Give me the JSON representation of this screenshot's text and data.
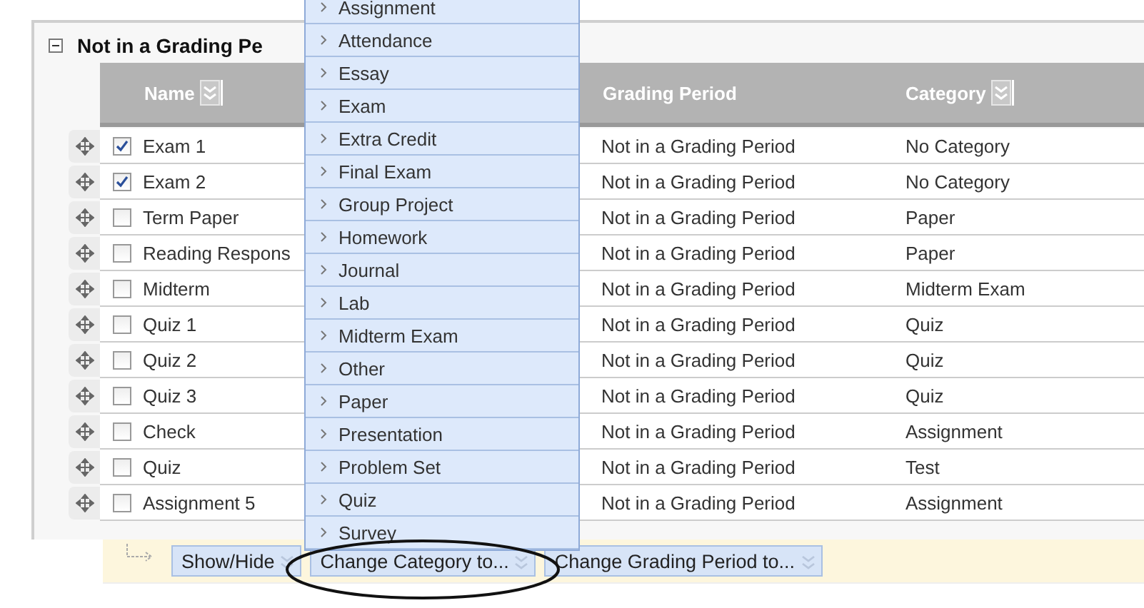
{
  "section": {
    "title": "Not in a Grading Pe",
    "expanded": true
  },
  "table": {
    "columns": [
      {
        "label": "Name",
        "sortable": true
      },
      {
        "label": "Grading Period",
        "sortable": false
      },
      {
        "label": "Category",
        "sortable": true
      }
    ],
    "rows": [
      {
        "name": "Exam 1",
        "checked": true,
        "grading_period": "Not in a Grading Period",
        "category": "No Category"
      },
      {
        "name": "Exam 2",
        "checked": true,
        "grading_period": "Not in a Grading Period",
        "category": "No Category"
      },
      {
        "name": "Term Paper",
        "checked": false,
        "grading_period": "Not in a Grading Period",
        "category": "Paper"
      },
      {
        "name": "Reading Respons",
        "checked": false,
        "grading_period": "Not in a Grading Period",
        "category": "Paper"
      },
      {
        "name": "Midterm",
        "checked": false,
        "grading_period": "Not in a Grading Period",
        "category": "Midterm Exam"
      },
      {
        "name": "Quiz 1",
        "checked": false,
        "grading_period": "Not in a Grading Period",
        "category": "Quiz"
      },
      {
        "name": "Quiz 2",
        "checked": false,
        "grading_period": "Not in a Grading Period",
        "category": "Quiz"
      },
      {
        "name": "Quiz 3",
        "checked": false,
        "grading_period": "Not in a Grading Period",
        "category": "Quiz"
      },
      {
        "name": "Check",
        "checked": false,
        "grading_period": "Not in a Grading Period",
        "category": "Assignment"
      },
      {
        "name": "Quiz",
        "checked": false,
        "grading_period": "Not in a Grading Period",
        "category": "Test"
      },
      {
        "name": "Assignment 5",
        "checked": false,
        "grading_period": "Not in a Grading Period",
        "category": "Assignment"
      }
    ]
  },
  "category_menu": {
    "items": [
      "Assignment",
      "Attendance",
      "Essay",
      "Exam",
      "Extra Credit",
      "Final Exam",
      "Group Project",
      "Homework",
      "Journal",
      "Lab",
      "Midterm Exam",
      "Other",
      "Paper",
      "Presentation",
      "Problem Set",
      "Quiz",
      "Survey"
    ]
  },
  "action_bar": {
    "buttons": [
      "Show/Hide",
      "Change Category to...",
      "Change Grading Period to..."
    ]
  }
}
